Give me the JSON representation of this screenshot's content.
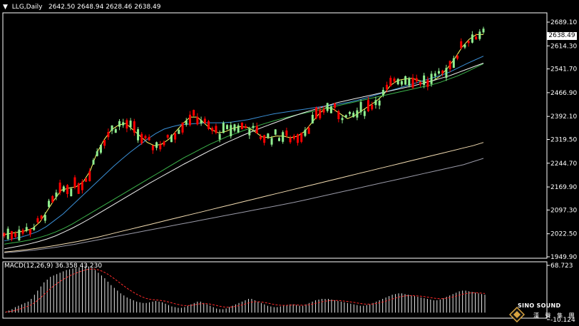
{
  "header": {
    "symbol": "LLG,Daily",
    "ohlc": "2642.50 2648.94 2628.46 2638.49",
    "dropdown_icon": "triangle-down-icon"
  },
  "current_price_label": "2638.49",
  "macd_header": "MACD(12,26,9) 36.358 43.230",
  "logo": {
    "word": "SINO SOUND",
    "sub": "漢 聲 集 團"
  },
  "colors": {
    "background": "#000000",
    "up_candle": "#ff0000",
    "down_candle": "#90ee90",
    "ma_fast": "#ffff66",
    "ma_blue": "#3a8fd6",
    "ma_green": "#3cb44b",
    "ma_white": "#f0f0f0",
    "ma_beige": "#f5deb3",
    "ma_grey": "#9a9aa8",
    "macd_hist": "#e6e6e6",
    "macd_signal": "#ff2a2a",
    "axis": "#ffffff"
  },
  "chart_data": {
    "type": "candlestick",
    "title": "LLG,Daily",
    "y_ticks_main": [
      "2689.10",
      "2614.30",
      "2541.70",
      "2466.90",
      "2392.10",
      "2319.50",
      "2244.70",
      "2169.90",
      "2097.30",
      "2022.50",
      "1949.90"
    ],
    "ylim_main": [
      1949.9,
      2689.1
    ],
    "y_ticks_macd": [
      "68.723",
      "-10.124"
    ],
    "ylim_macd": [
      -10.124,
      68.723
    ],
    "grid": false,
    "series": [
      {
        "name": "MA fast",
        "values": [
          2020,
          2024,
          2028,
          2032,
          2040,
          2060,
          2095,
          2130,
          2160,
          2166,
          2170,
          2185,
          2220,
          2280,
          2320,
          2350,
          2365,
          2370,
          2350,
          2330,
          2310,
          2300,
          2305,
          2320,
          2345,
          2370,
          2390,
          2390,
          2370,
          2350,
          2340,
          2345,
          2355,
          2360,
          2358,
          2345,
          2328,
          2325,
          2330,
          2330,
          2325,
          2330,
          2345,
          2372,
          2400,
          2420,
          2415,
          2400,
          2385,
          2395,
          2410,
          2425,
          2440,
          2460,
          2490,
          2505,
          2510,
          2512,
          2505,
          2500,
          2505,
          2520,
          2545,
          2575,
          2610,
          2635,
          2650,
          2650
        ]
      },
      {
        "name": "MA blue",
        "values": [
          2000,
          2006,
          2012,
          2020,
          2030,
          2045,
          2065,
          2085,
          2110,
          2135,
          2160,
          2185,
          2210,
          2235,
          2258,
          2280,
          2300,
          2320,
          2338,
          2352,
          2360,
          2366,
          2368,
          2370,
          2372,
          2372,
          2372,
          2374,
          2378,
          2382,
          2388,
          2394,
          2400,
          2404,
          2408,
          2412,
          2416,
          2420,
          2424,
          2428,
          2432,
          2437,
          2443,
          2450,
          2458,
          2466,
          2474,
          2482,
          2490,
          2498,
          2506,
          2514,
          2522,
          2532,
          2545,
          2558,
          2570,
          2582
        ]
      },
      {
        "name": "MA green",
        "values": [
          1990,
          1994,
          1998,
          2003,
          2010,
          2018,
          2028,
          2040,
          2054,
          2070,
          2086,
          2102,
          2118,
          2134,
          2150,
          2166,
          2182,
          2198,
          2214,
          2230,
          2246,
          2262,
          2276,
          2290,
          2304,
          2316,
          2328,
          2338,
          2348,
          2357,
          2366,
          2374,
          2382,
          2389,
          2396,
          2402,
          2408,
          2414,
          2420,
          2426,
          2432,
          2438,
          2444,
          2450,
          2456,
          2462,
          2468,
          2474,
          2480,
          2486,
          2492,
          2500,
          2510,
          2520,
          2532,
          2545,
          2558
        ]
      },
      {
        "name": "MA white",
        "values": [
          1975,
          1980,
          1985,
          1991,
          1998,
          2006,
          2016,
          2028,
          2041,
          2055,
          2070,
          2086,
          2102,
          2118,
          2134,
          2150,
          2166,
          2182,
          2197,
          2212,
          2227,
          2242,
          2256,
          2270,
          2284,
          2297,
          2310,
          2322,
          2334,
          2345,
          2356,
          2366,
          2376,
          2386,
          2395,
          2404,
          2412,
          2420,
          2428,
          2436,
          2442,
          2448,
          2454,
          2460,
          2466,
          2472,
          2478,
          2484,
          2490,
          2497,
          2504,
          2512,
          2520,
          2530,
          2540,
          2550,
          2560
        ]
      },
      {
        "name": "MA beige",
        "values": [
          1965,
          1968,
          1972,
          1976,
          1981,
          1986,
          1992,
          1998,
          2005,
          2012,
          2020,
          2028,
          2036,
          2044,
          2052,
          2060,
          2068,
          2076,
          2084,
          2092,
          2100,
          2108,
          2116,
          2124,
          2132,
          2140,
          2148,
          2156,
          2164,
          2172,
          2180,
          2188,
          2196,
          2204,
          2212,
          2220,
          2228,
          2236,
          2244,
          2252,
          2260,
          2268,
          2276,
          2284,
          2292,
          2300,
          2310
        ]
      },
      {
        "name": "MA grey",
        "values": [
          1963,
          1965,
          1968,
          1971,
          1975,
          1979,
          1984,
          1989,
          1995,
          2001,
          2007,
          2013,
          2019,
          2025,
          2031,
          2037,
          2043,
          2049,
          2055,
          2061,
          2067,
          2073,
          2079,
          2085,
          2091,
          2097,
          2103,
          2109,
          2115,
          2121,
          2128,
          2135,
          2142,
          2149,
          2156,
          2163,
          2170,
          2177,
          2184,
          2191,
          2198,
          2205,
          2212,
          2219,
          2226,
          2233,
          2240,
          2250,
          2260
        ]
      }
    ],
    "macd_hist": [
      1,
      3,
      5,
      8,
      10,
      12,
      14,
      16,
      20,
      26,
      32,
      38,
      44,
      48,
      52,
      54,
      56,
      58,
      60,
      62,
      63,
      64,
      65,
      66,
      67,
      68,
      67,
      65,
      62,
      58,
      54,
      50,
      45,
      40,
      36,
      32,
      28,
      25,
      22,
      20,
      18,
      16,
      15,
      14,
      14,
      15,
      16,
      17,
      16,
      15,
      13,
      11,
      9,
      8,
      7,
      7,
      8,
      10,
      12,
      14,
      16,
      16,
      14,
      12,
      10,
      8,
      6,
      5,
      5,
      6,
      8,
      10,
      12,
      14,
      16,
      18,
      20,
      20,
      18,
      16,
      14,
      12,
      10,
      9,
      8,
      8,
      9,
      10,
      11,
      12,
      12,
      11,
      10,
      10,
      12,
      14,
      16,
      18,
      19,
      20,
      20,
      20,
      19,
      18,
      17,
      16,
      15,
      14,
      13,
      12,
      11,
      10,
      10,
      11,
      12,
      14,
      16,
      18,
      20,
      22,
      24,
      26,
      27,
      28,
      28,
      27,
      26,
      25,
      24,
      23,
      22,
      21,
      20,
      19,
      18,
      18,
      19,
      21,
      23,
      25,
      27,
      29,
      31,
      32,
      32,
      31,
      30,
      29,
      28,
      27,
      26
    ]
  }
}
